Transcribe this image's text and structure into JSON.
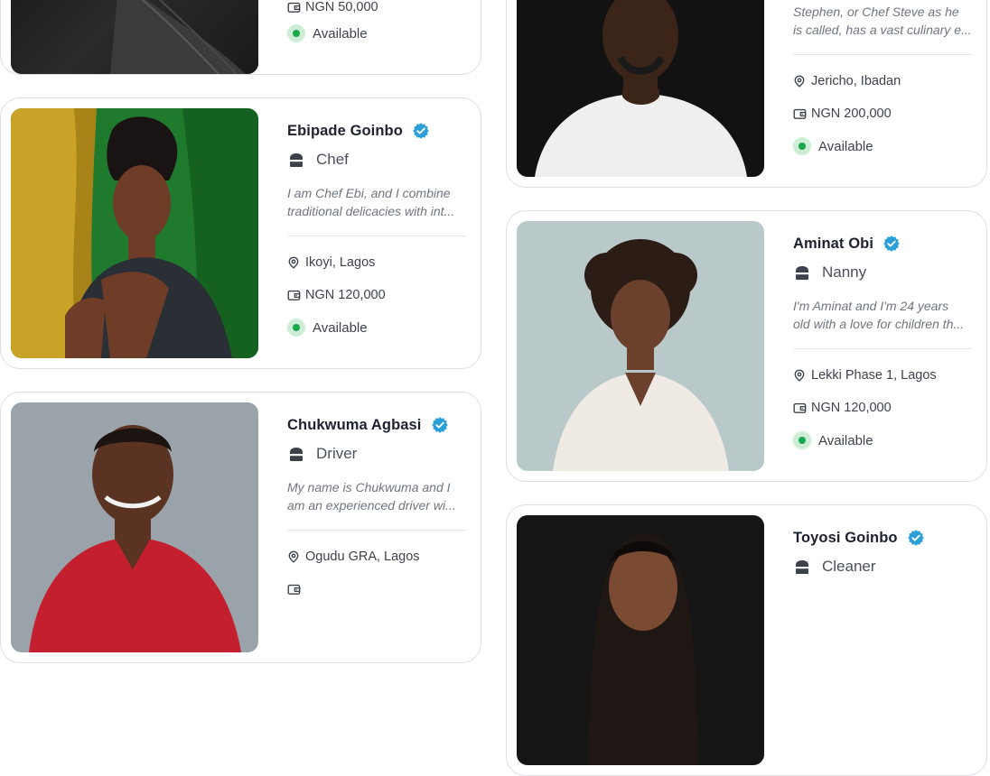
{
  "cards": [
    {
      "name": "",
      "role": "",
      "description": [
        "",
        ""
      ],
      "location": "",
      "price": "NGN 50,000",
      "status": "Available",
      "verified": false
    },
    {
      "name": "Ebipade Goinbo",
      "role": "Chef",
      "description": [
        "I am Chef Ebi, and I combine",
        "traditional delicacies with int..."
      ],
      "location": "Ikoyi, Lagos",
      "price": "NGN 120,000",
      "status": "Available",
      "verified": true
    },
    {
      "name": "Chukwuma Agbasi",
      "role": "Driver",
      "description": [
        "My name is Chukwuma and I",
        "am an experienced driver wi..."
      ],
      "location": "Ogudu GRA, Lagos",
      "price": "",
      "status": "",
      "verified": true
    },
    {
      "name": "",
      "role": "",
      "description": [
        "Stephen, or Chef Steve as he",
        "is called, has a vast culinary e..."
      ],
      "location": "Jericho, Ibadan",
      "price": "NGN 200,000",
      "status": "Available",
      "verified": false
    },
    {
      "name": "Aminat Obi",
      "role": "Nanny",
      "description": [
        "I'm Aminat and I'm 24 years",
        "old with a love for children th..."
      ],
      "location": "Lekki Phase 1, Lagos",
      "price": "NGN 120,000",
      "status": "Available",
      "verified": true
    },
    {
      "name": "Toyosi Goinbo",
      "role": "Cleaner",
      "description": [
        "",
        ""
      ],
      "location": "",
      "price": "",
      "status": "",
      "verified": true
    }
  ],
  "icons": {
    "verified": "verified-badge-icon",
    "role": "role-hat-icon",
    "location": "location-pin-icon",
    "price": "wallet-icon",
    "status": "status-dot-icon"
  },
  "colors": {
    "verified_badge": "#2a9fd8",
    "available_dot": "#1aa64a",
    "available_ring": "#cdeed5",
    "card_border": "#dcdfe4"
  }
}
